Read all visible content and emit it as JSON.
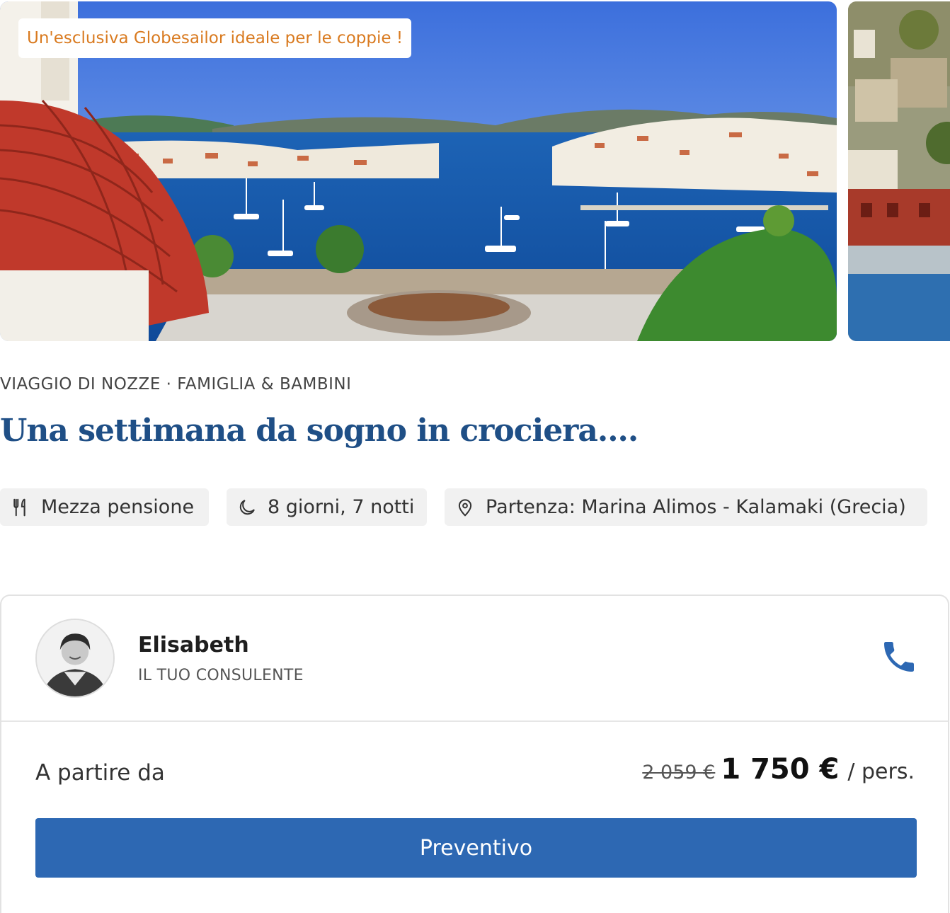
{
  "gallery": {
    "badge": "Un'esclusiva Globesailor ideale per le coppie !"
  },
  "trip": {
    "categories": "Viaggio di nozze · Famiglia & Bambini",
    "title": "Una settimana da sogno in crociera....",
    "features": [
      {
        "icon": "utensils-icon",
        "label": "Mezza pensione"
      },
      {
        "icon": "moon-icon",
        "label": "8 giorni, 7 notti"
      },
      {
        "icon": "map-pin-icon",
        "label": "Partenza: Marina Alimos - Kalamaki (Grecia)"
      }
    ]
  },
  "consultant": {
    "name": "Elisabeth",
    "role": "IL TUO CONSULENTE",
    "action_icon": "phone-icon"
  },
  "pricing": {
    "from_label": "A partire da",
    "old_price": "2 059 €",
    "price": "1 750 €",
    "unit": "/ pers."
  },
  "cta": {
    "label": "Preventivo"
  },
  "colors": {
    "brand_blue": "#2d68b3",
    "title_blue": "#1f4f86",
    "badge_orange": "#d97a1f"
  }
}
